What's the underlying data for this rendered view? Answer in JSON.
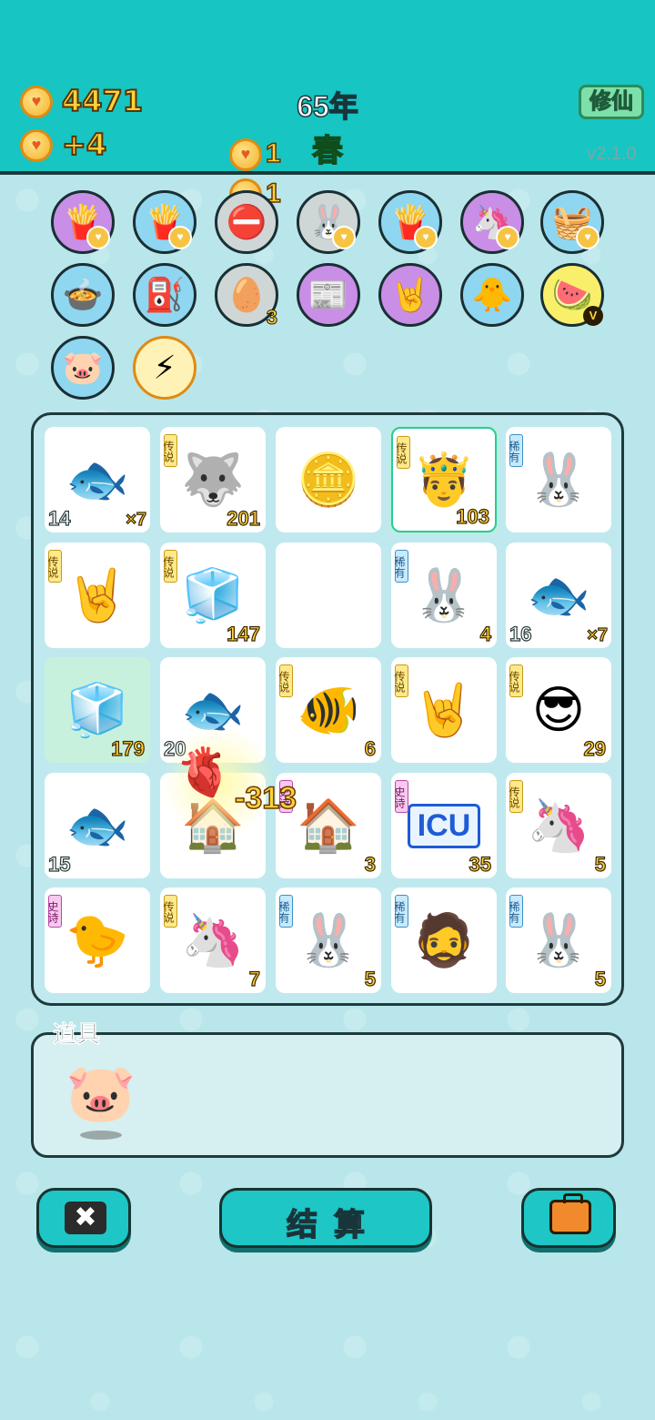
{
  "header": {
    "coins": "4471",
    "income": "+4",
    "year": "65年",
    "season": "春",
    "mode_button": "修仙",
    "version": "v2.1.0",
    "floating_gains": [
      "1",
      "1"
    ]
  },
  "symbol_rows": [
    [
      {
        "name": "fries-icon",
        "glyph": "🍟",
        "bg": "purple"
      },
      {
        "name": "fries-icon",
        "glyph": "🍟",
        "bg": "blue"
      },
      {
        "name": "no-entry-icon",
        "glyph": "⛔",
        "bg": "gray"
      },
      {
        "name": "rabbit-icon",
        "glyph": "🐰",
        "bg": "gray"
      },
      {
        "name": "fries-icon",
        "glyph": "🍟",
        "bg": "blue"
      },
      {
        "name": "unicorn-pair-icon",
        "glyph": "🦄",
        "bg": "purple"
      },
      {
        "name": "fruit-basket-icon",
        "glyph": "🧺",
        "bg": "blue"
      }
    ],
    [
      {
        "name": "pot-duck-icon",
        "glyph": "🍲",
        "bg": "blue"
      },
      {
        "name": "pump-icon",
        "glyph": "⛽",
        "bg": "blue"
      },
      {
        "name": "egg-tray-icon",
        "glyph": "🥚",
        "bg": "gray",
        "count": "3"
      },
      {
        "name": "time-magazine-icon",
        "glyph": "📰",
        "bg": "purple"
      },
      {
        "name": "rock-hand-icon",
        "glyph": "🤘",
        "bg": "purple"
      },
      {
        "name": "chick-egg-icon",
        "glyph": "🐥",
        "bg": "blue"
      },
      {
        "name": "fruit-platter-icon",
        "glyph": "🍉",
        "bg": "yellow",
        "v": "V"
      }
    ],
    [
      {
        "name": "piggy-bank-icon",
        "glyph": "🐷",
        "bg": "blue"
      },
      {
        "name": "lightning-icon",
        "glyph": "⚡",
        "bg": "cream"
      }
    ]
  ],
  "board": [
    [
      {
        "name": "fish-icon",
        "glyph": "🐟",
        "left": "14",
        "mult": "×7"
      },
      {
        "name": "husky-king-icon",
        "glyph": "🐺",
        "tag": "传说",
        "tag_type": "leg",
        "count": "201"
      },
      {
        "name": "coins-pile-icon",
        "glyph": "🪙"
      },
      {
        "name": "king-face-icon",
        "glyph": "🤴",
        "tag": "传说",
        "tag_type": "leg",
        "count": "103",
        "highlight": true
      },
      {
        "name": "rabbit-icon",
        "glyph": "🐰",
        "tag": "稀有",
        "tag_type": "rare"
      }
    ],
    [
      {
        "name": "golden-hand-icon",
        "glyph": "🤘",
        "tag": "传说",
        "tag_type": "leg"
      },
      {
        "name": "fridge-king-icon",
        "glyph": "🧊",
        "tag": "传说",
        "tag_type": "leg",
        "count": "147"
      },
      {
        "name": "empty-slot",
        "glyph": ""
      },
      {
        "name": "rabbit-icon",
        "glyph": "🐰",
        "tag": "稀有",
        "tag_type": "rare",
        "count": "4"
      },
      {
        "name": "fish-icon",
        "glyph": "🐟",
        "left": "16",
        "mult": "×7"
      }
    ],
    [
      {
        "name": "fridge-icon",
        "glyph": "🧊",
        "count": "179",
        "glow": true
      },
      {
        "name": "fish-icon",
        "glyph": "🐟",
        "left": "20"
      },
      {
        "name": "koi-icon",
        "glyph": "🐠",
        "tag": "传说",
        "tag_type": "leg",
        "count": "6"
      },
      {
        "name": "golden-hand-icon",
        "glyph": "🤘",
        "tag": "传说",
        "tag_type": "leg"
      },
      {
        "name": "sunglasses-king-icon",
        "glyph": "😎",
        "tag": "传说",
        "tag_type": "leg",
        "count": "29"
      }
    ],
    [
      {
        "name": "fish-icon",
        "glyph": "🐟",
        "left": "15"
      },
      {
        "name": "rabbit-house-icon",
        "glyph": "🏠"
      },
      {
        "name": "rabbit-house-icon",
        "glyph": "🏠",
        "tag": "史诗",
        "tag_type": "epic",
        "count": "3"
      },
      {
        "name": "icu-icon",
        "glyph": "ICU",
        "tag": "史诗",
        "tag_type": "epic",
        "count": "35",
        "icu": true
      },
      {
        "name": "unicorn-icon",
        "glyph": "🦄",
        "tag": "传说",
        "tag_type": "leg",
        "count": "5"
      }
    ],
    [
      {
        "name": "chick-hair-icon",
        "glyph": "🐤",
        "tag": "史诗",
        "tag_type": "epic"
      },
      {
        "name": "unicorn-icon",
        "glyph": "🦄",
        "tag": "传说",
        "tag_type": "leg",
        "count": "7"
      },
      {
        "name": "rabbit-icon",
        "glyph": "🐰",
        "tag": "稀有",
        "tag_type": "rare",
        "count": "5"
      },
      {
        "name": "bucket-hat-man-icon",
        "glyph": "🧔",
        "tag": "稀有",
        "tag_type": "rare"
      },
      {
        "name": "rabbit-icon",
        "glyph": "🐰",
        "tag": "稀有",
        "tag_type": "rare",
        "count": "5"
      }
    ]
  ],
  "effect": {
    "damage": "-313",
    "liver_glyph": "🫀"
  },
  "items": {
    "title": "道具",
    "pig_glyph": "🐷"
  },
  "buttons": {
    "close": "✖",
    "settle": "结算"
  }
}
